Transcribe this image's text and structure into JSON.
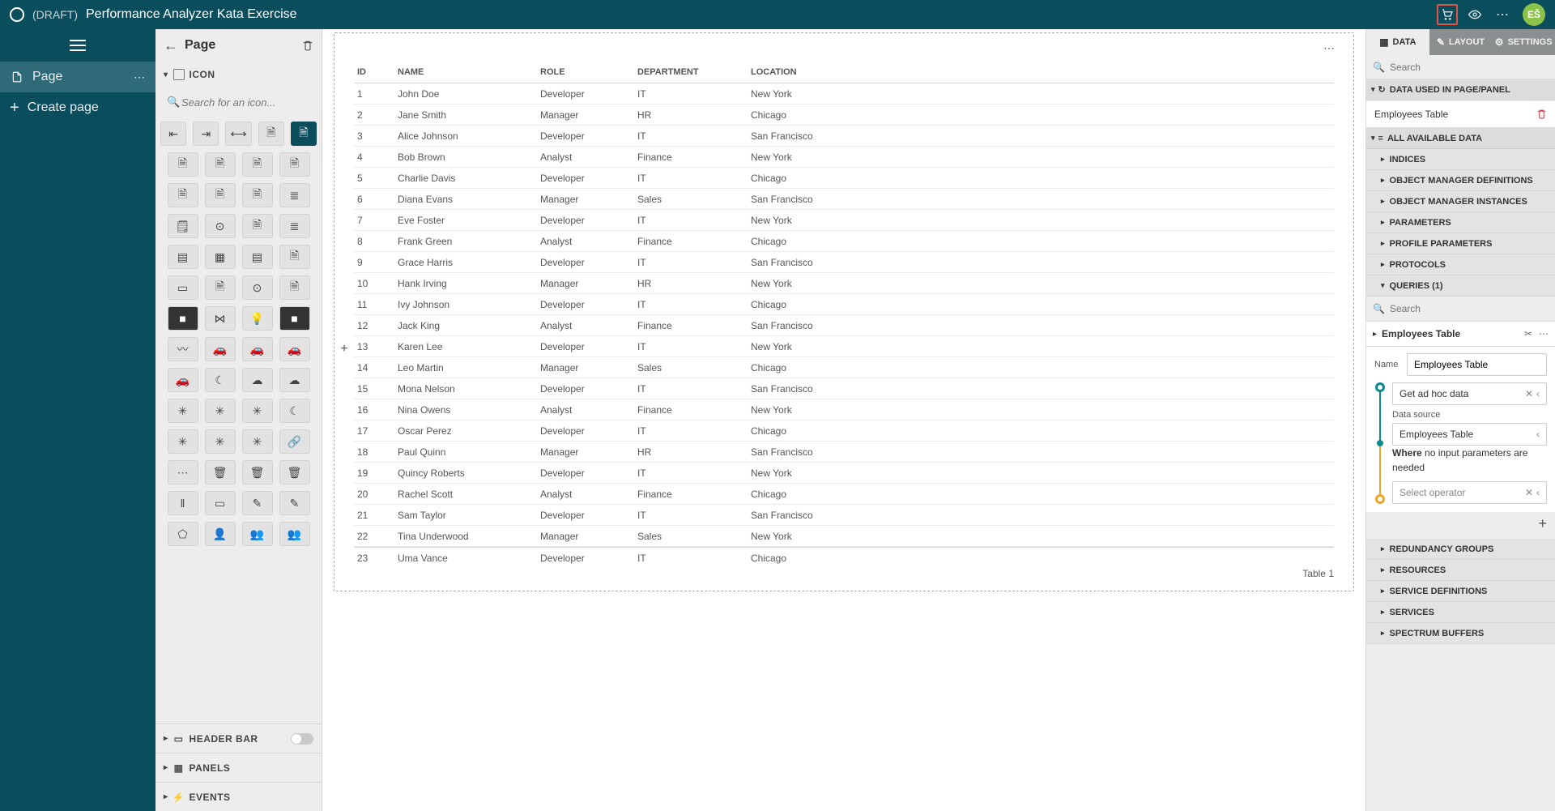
{
  "header": {
    "draft": "(DRAFT)",
    "title": "Performance Analyzer Kata Exercise",
    "avatar": "EŠ"
  },
  "leftNav": {
    "page": "Page",
    "createPage": "Create page"
  },
  "iconPanel": {
    "title": "Page",
    "section": "ICON",
    "searchPlaceholder": "Search for an icon...",
    "collapsed": {
      "headerBar": "HEADER BAR",
      "panels": "PANELS",
      "events": "EVENTS"
    }
  },
  "table": {
    "columns": [
      "ID",
      "NAME",
      "ROLE",
      "DEPARTMENT",
      "LOCATION"
    ],
    "rows": [
      {
        "id": "1",
        "name": "John Doe",
        "role": "Developer",
        "dept": "IT",
        "loc": "New York"
      },
      {
        "id": "2",
        "name": "Jane Smith",
        "role": "Manager",
        "dept": "HR",
        "loc": "Chicago"
      },
      {
        "id": "3",
        "name": "Alice Johnson",
        "role": "Developer",
        "dept": "IT",
        "loc": "San Francisco"
      },
      {
        "id": "4",
        "name": "Bob Brown",
        "role": "Analyst",
        "dept": "Finance",
        "loc": "New York"
      },
      {
        "id": "5",
        "name": "Charlie Davis",
        "role": "Developer",
        "dept": "IT",
        "loc": "Chicago"
      },
      {
        "id": "6",
        "name": "Diana Evans",
        "role": "Manager",
        "dept": "Sales",
        "loc": "San Francisco"
      },
      {
        "id": "7",
        "name": "Eve Foster",
        "role": "Developer",
        "dept": "IT",
        "loc": "New York"
      },
      {
        "id": "8",
        "name": "Frank Green",
        "role": "Analyst",
        "dept": "Finance",
        "loc": "Chicago"
      },
      {
        "id": "9",
        "name": "Grace Harris",
        "role": "Developer",
        "dept": "IT",
        "loc": "San Francisco"
      },
      {
        "id": "10",
        "name": "Hank Irving",
        "role": "Manager",
        "dept": "HR",
        "loc": "New York"
      },
      {
        "id": "11",
        "name": "Ivy Johnson",
        "role": "Developer",
        "dept": "IT",
        "loc": "Chicago"
      },
      {
        "id": "12",
        "name": "Jack King",
        "role": "Analyst",
        "dept": "Finance",
        "loc": "San Francisco"
      },
      {
        "id": "13",
        "name": "Karen Lee",
        "role": "Developer",
        "dept": "IT",
        "loc": "New York"
      },
      {
        "id": "14",
        "name": "Leo Martin",
        "role": "Manager",
        "dept": "Sales",
        "loc": "Chicago"
      },
      {
        "id": "15",
        "name": "Mona Nelson",
        "role": "Developer",
        "dept": "IT",
        "loc": "San Francisco"
      },
      {
        "id": "16",
        "name": "Nina Owens",
        "role": "Analyst",
        "dept": "Finance",
        "loc": "New York"
      },
      {
        "id": "17",
        "name": "Oscar Perez",
        "role": "Developer",
        "dept": "IT",
        "loc": "Chicago"
      },
      {
        "id": "18",
        "name": "Paul Quinn",
        "role": "Manager",
        "dept": "HR",
        "loc": "San Francisco"
      },
      {
        "id": "19",
        "name": "Quincy Roberts",
        "role": "Developer",
        "dept": "IT",
        "loc": "New York"
      },
      {
        "id": "20",
        "name": "Rachel Scott",
        "role": "Analyst",
        "dept": "Finance",
        "loc": "Chicago"
      },
      {
        "id": "21",
        "name": "Sam Taylor",
        "role": "Developer",
        "dept": "IT",
        "loc": "San Francisco"
      },
      {
        "id": "22",
        "name": "Tina Underwood",
        "role": "Manager",
        "dept": "Sales",
        "loc": "New York"
      },
      {
        "id": "23",
        "name": "Uma Vance",
        "role": "Developer",
        "dept": "IT",
        "loc": "Chicago"
      }
    ],
    "footer": "Table 1"
  },
  "right": {
    "tabs": {
      "data": "DATA",
      "layout": "LAYOUT",
      "settings": "SETTINGS"
    },
    "searchPlaceholder": "Search",
    "dataUsed": "DATA USED IN PAGE/PANEL",
    "usedItem": "Employees Table",
    "allAvailable": "ALL AVAILABLE DATA",
    "tree": {
      "indices": "INDICES",
      "omd": "OBJECT MANAGER DEFINITIONS",
      "omi": "OBJECT MANAGER INSTANCES",
      "params": "PARAMETERS",
      "pparams": "PROFILE PARAMETERS",
      "proto": "PROTOCOLS",
      "queries": "QUERIES (1)",
      "redund": "REDUNDANCY GROUPS",
      "res": "RESOURCES",
      "sdef": "SERVICE DEFINITIONS",
      "svc": "SERVICES",
      "sbuf": "SPECTRUM BUFFERS"
    },
    "querySearchPlaceholder": "Search",
    "query": {
      "title": "Employees Table",
      "nameLabel": "Name",
      "nameValue": "Employees Table",
      "adhoc": "Get ad hoc data",
      "dsLabel": "Data source",
      "dsValue": "Employees Table",
      "whereBold": "Where",
      "whereRest": "no input parameters are needed",
      "selectOp": "Select operator"
    }
  }
}
